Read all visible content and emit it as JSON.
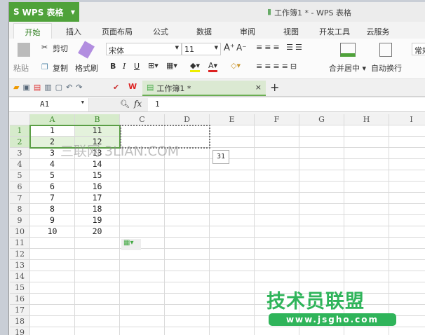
{
  "titlebar": {
    "app_button": "WPS 表格",
    "title": "工作簿1 * - WPS 表格"
  },
  "tabs": [
    "开始",
    "插入",
    "页面布局",
    "公式",
    "数据",
    "审阅",
    "视图",
    "开发工具",
    "云服务"
  ],
  "active_tab": "开始",
  "ribbon": {
    "paste": "粘贴",
    "cut": "剪切",
    "copy": "复制",
    "format_painter": "格式刷",
    "font_name": "宋体",
    "font_size": "11",
    "bold": "B",
    "italic": "I",
    "underline": "U",
    "merge_center": "合并居中",
    "wrap_text": "自动换行",
    "number_format": "常规"
  },
  "doc_tab": {
    "name": "工作簿1 *",
    "close": "×",
    "add": "+"
  },
  "formula_bar": {
    "name_box": "A1",
    "fx": "fx",
    "value": "1"
  },
  "sheet": {
    "columns": [
      "A",
      "B",
      "C",
      "D",
      "E",
      "F",
      "G",
      "H",
      "I"
    ],
    "rows": [
      "1",
      "2",
      "3",
      "4",
      "5",
      "6",
      "7",
      "8",
      "9",
      "10",
      "11",
      "12",
      "13",
      "14",
      "15",
      "16",
      "17",
      "18",
      "19"
    ],
    "col_a": [
      "1",
      "2",
      "3",
      "4",
      "5",
      "6",
      "7",
      "8",
      "9",
      "10"
    ],
    "col_b": [
      "11",
      "12",
      "13",
      "14",
      "15",
      "16",
      "17",
      "18",
      "19",
      "20"
    ],
    "selection": "A1:B2",
    "copy_marquee": "C1:D2",
    "tooltip": "31"
  },
  "watermarks": {
    "sanlian": "三联网 3LIAN.COM",
    "brand": "技术员联盟",
    "url": "www.jsgho.com"
  },
  "colors": {
    "accent": "#4fa23a",
    "selection": "#5a9e45",
    "brand_watermark": "#2fb45a"
  }
}
